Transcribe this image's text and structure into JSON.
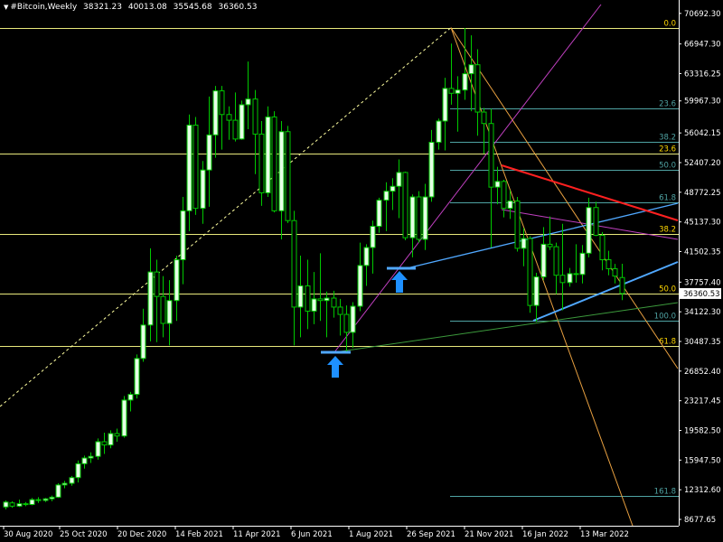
{
  "header": {
    "symbol": "#Bitcoin,Weekly",
    "open": "38321.23",
    "high": "40013.08",
    "low": "35545.68",
    "close": "36360.53",
    "menu_icon": "triangle-down-icon"
  },
  "colors": {
    "background": "#000000",
    "bull": "#e6ffe6",
    "bear": "#000000",
    "wick": "#00c800",
    "grid_axis": "#ffffff",
    "h_levels": "#e8e87c",
    "fib_retr": "#4fa3a3",
    "fib_fan_orange": "#e8a040",
    "pitchfork_magenta": "#c040c0",
    "channel_blue": "#50a8ff",
    "trend_red": "#ff2020",
    "trend_green": "#3c9a3c",
    "arrow_blue": "#1e90ff",
    "dotted_white": "#ffffa0"
  },
  "y_axis": {
    "labels": [
      "70692.30",
      "66947.30",
      "63316.25",
      "59967.30",
      "56042.15",
      "52407.20",
      "48772.25",
      "45137.30",
      "41502.35",
      "37757.40",
      "34122.30",
      "30487.35",
      "26852.40",
      "23217.45",
      "19582.50",
      "15947.50",
      "12312.60",
      "8677.65"
    ],
    "current_price": "36360.53"
  },
  "x_axis": {
    "labels": [
      "30 Aug 2020",
      "25 Oct 2020",
      "20 Dec 2020",
      "14 Feb 2021",
      "11 Apr 2021",
      "6 Jun 2021",
      "1 Aug 2021",
      "26 Sep 2021",
      "21 Nov 2021",
      "16 Jan 2022",
      "13 Mar 2022"
    ]
  },
  "horizontal_levels": [
    {
      "price": 68950,
      "label": "0.0"
    },
    {
      "price": 53500,
      "label": "23.6"
    },
    {
      "price": 43700,
      "label": "38.2"
    },
    {
      "price": 36400,
      "label": "50.0"
    },
    {
      "price": 29900,
      "label": "61.8"
    }
  ],
  "fib_retracement_levels": [
    {
      "price": 59100,
      "label": "23.6"
    },
    {
      "price": 55000,
      "label": "38.2"
    },
    {
      "price": 51500,
      "label": "50.0"
    },
    {
      "price": 47500,
      "label": "61.8"
    },
    {
      "price": 33000,
      "label": "100.0"
    },
    {
      "price": 11600,
      "label": "161.8"
    }
  ],
  "annotations": [
    {
      "type": "arrow-up",
      "name": "buy-arrow-icon"
    },
    {
      "type": "arrow-up",
      "name": "buy-arrow-icon"
    }
  ],
  "chart_data": {
    "type": "candlestick",
    "title": "#Bitcoin,Weekly",
    "ohlc_header": {
      "open": 38321.23,
      "high": 40013.08,
      "low": 35545.68,
      "close": 36360.53
    },
    "ylim": [
      8000,
      71500
    ],
    "y_ticks": [
      70692.3,
      66947.3,
      63316.25,
      59967.3,
      56042.15,
      52407.2,
      48772.25,
      45137.3,
      41502.35,
      37757.4,
      34122.3,
      30487.35,
      26852.4,
      23217.45,
      19582.5,
      15947.5,
      12312.6,
      8677.65
    ],
    "candles": [
      {
        "o": 10200,
        "h": 11000,
        "l": 9900,
        "c": 10800
      },
      {
        "o": 10700,
        "h": 10900,
        "l": 10100,
        "c": 10300
      },
      {
        "o": 10300,
        "h": 11100,
        "l": 10200,
        "c": 10600
      },
      {
        "o": 10600,
        "h": 10800,
        "l": 10300,
        "c": 10500
      },
      {
        "o": 10500,
        "h": 11300,
        "l": 10400,
        "c": 11100
      },
      {
        "o": 11100,
        "h": 11400,
        "l": 10700,
        "c": 11000
      },
      {
        "o": 11000,
        "h": 11300,
        "l": 10800,
        "c": 11200
      },
      {
        "o": 11200,
        "h": 11600,
        "l": 10900,
        "c": 11400
      },
      {
        "o": 11400,
        "h": 13100,
        "l": 11300,
        "c": 12900
      },
      {
        "o": 12900,
        "h": 13400,
        "l": 12500,
        "c": 13100
      },
      {
        "o": 13100,
        "h": 14000,
        "l": 12800,
        "c": 13800
      },
      {
        "o": 13800,
        "h": 15900,
        "l": 13200,
        "c": 15500
      },
      {
        "o": 15500,
        "h": 16500,
        "l": 14900,
        "c": 16200
      },
      {
        "o": 16200,
        "h": 16900,
        "l": 15600,
        "c": 16400
      },
      {
        "o": 16400,
        "h": 18600,
        "l": 16000,
        "c": 18200
      },
      {
        "o": 18200,
        "h": 19300,
        "l": 16700,
        "c": 17800
      },
      {
        "o": 17800,
        "h": 19600,
        "l": 17400,
        "c": 19200
      },
      {
        "o": 19200,
        "h": 19800,
        "l": 18200,
        "c": 18900
      },
      {
        "o": 18900,
        "h": 23800,
        "l": 18700,
        "c": 23300
      },
      {
        "o": 23300,
        "h": 24300,
        "l": 21900,
        "c": 24000
      },
      {
        "o": 24000,
        "h": 28900,
        "l": 23500,
        "c": 28400
      },
      {
        "o": 28400,
        "h": 34500,
        "l": 28000,
        "c": 32500
      },
      {
        "o": 32500,
        "h": 41900,
        "l": 30500,
        "c": 39000
      },
      {
        "o": 39000,
        "h": 40500,
        "l": 30400,
        "c": 36000
      },
      {
        "o": 36000,
        "h": 38500,
        "l": 31000,
        "c": 32700
      },
      {
        "o": 32700,
        "h": 38000,
        "l": 30000,
        "c": 35500
      },
      {
        "o": 35500,
        "h": 41000,
        "l": 33000,
        "c": 40500
      },
      {
        "o": 40500,
        "h": 48200,
        "l": 37500,
        "c": 46500
      },
      {
        "o": 46500,
        "h": 58300,
        "l": 44000,
        "c": 57000
      },
      {
        "o": 57000,
        "h": 58000,
        "l": 46000,
        "c": 46800
      },
      {
        "o": 46800,
        "h": 52600,
        "l": 44900,
        "c": 51500
      },
      {
        "o": 51500,
        "h": 60500,
        "l": 47000,
        "c": 55800
      },
      {
        "o": 55800,
        "h": 61800,
        "l": 53000,
        "c": 61200
      },
      {
        "o": 61200,
        "h": 61800,
        "l": 54000,
        "c": 58300
      },
      {
        "o": 58300,
        "h": 59300,
        "l": 55200,
        "c": 57600
      },
      {
        "o": 57600,
        "h": 61000,
        "l": 55000,
        "c": 55300
      },
      {
        "o": 55300,
        "h": 60000,
        "l": 55200,
        "c": 59500
      },
      {
        "o": 59500,
        "h": 64800,
        "l": 56500,
        "c": 60200
      },
      {
        "o": 60200,
        "h": 61300,
        "l": 51000,
        "c": 55900
      },
      {
        "o": 55900,
        "h": 57500,
        "l": 47100,
        "c": 48700
      },
      {
        "o": 48700,
        "h": 59300,
        "l": 48200,
        "c": 58000
      },
      {
        "o": 58000,
        "h": 58700,
        "l": 46300,
        "c": 46500
      },
      {
        "o": 46500,
        "h": 57500,
        "l": 43000,
        "c": 56200
      },
      {
        "o": 56200,
        "h": 56900,
        "l": 45000,
        "c": 45300
      },
      {
        "o": 45300,
        "h": 46500,
        "l": 30000,
        "c": 34700
      },
      {
        "o": 34700,
        "h": 41000,
        "l": 31000,
        "c": 37300
      },
      {
        "o": 37300,
        "h": 40500,
        "l": 32000,
        "c": 34200
      },
      {
        "o": 34200,
        "h": 39000,
        "l": 32600,
        "c": 35700
      },
      {
        "o": 35700,
        "h": 41300,
        "l": 33000,
        "c": 35500
      },
      {
        "o": 35500,
        "h": 36600,
        "l": 31000,
        "c": 35800
      },
      {
        "o": 35800,
        "h": 36700,
        "l": 33400,
        "c": 34700
      },
      {
        "o": 34700,
        "h": 35700,
        "l": 31200,
        "c": 33800
      },
      {
        "o": 33800,
        "h": 34900,
        "l": 29300,
        "c": 31600
      },
      {
        "o": 31600,
        "h": 35300,
        "l": 29700,
        "c": 34800
      },
      {
        "o": 34800,
        "h": 42600,
        "l": 34200,
        "c": 39800
      },
      {
        "o": 39800,
        "h": 42400,
        "l": 37300,
        "c": 42000
      },
      {
        "o": 42000,
        "h": 45300,
        "l": 38800,
        "c": 44600
      },
      {
        "o": 44600,
        "h": 48100,
        "l": 43800,
        "c": 47800
      },
      {
        "o": 47800,
        "h": 50000,
        "l": 44000,
        "c": 48900
      },
      {
        "o": 48900,
        "h": 50500,
        "l": 46600,
        "c": 49500
      },
      {
        "o": 49500,
        "h": 52800,
        "l": 45600,
        "c": 51200
      },
      {
        "o": 51200,
        "h": 51300,
        "l": 42900,
        "c": 43200
      },
      {
        "o": 43200,
        "h": 48500,
        "l": 40800,
        "c": 48200
      },
      {
        "o": 48200,
        "h": 48900,
        "l": 42600,
        "c": 43000
      },
      {
        "o": 43000,
        "h": 49800,
        "l": 41700,
        "c": 48200
      },
      {
        "o": 48200,
        "h": 56400,
        "l": 47600,
        "c": 54900
      },
      {
        "o": 54900,
        "h": 57800,
        "l": 54000,
        "c": 57500
      },
      {
        "o": 57500,
        "h": 62800,
        "l": 53900,
        "c": 61500
      },
      {
        "o": 61500,
        "h": 67000,
        "l": 59500,
        "c": 60900
      },
      {
        "o": 60900,
        "h": 63000,
        "l": 56200,
        "c": 61300
      },
      {
        "o": 61300,
        "h": 68900,
        "l": 60100,
        "c": 63300
      },
      {
        "o": 63300,
        "h": 68000,
        "l": 58700,
        "c": 64400
      },
      {
        "o": 64400,
        "h": 66300,
        "l": 55700,
        "c": 58600
      },
      {
        "o": 58600,
        "h": 59100,
        "l": 53500,
        "c": 57200
      },
      {
        "o": 57200,
        "h": 59000,
        "l": 42000,
        "c": 49400
      },
      {
        "o": 49400,
        "h": 51900,
        "l": 47300,
        "c": 50100
      },
      {
        "o": 50100,
        "h": 50300,
        "l": 45700,
        "c": 46800
      },
      {
        "o": 46800,
        "h": 49000,
        "l": 45500,
        "c": 47700
      },
      {
        "o": 47700,
        "h": 48200,
        "l": 41500,
        "c": 41900
      },
      {
        "o": 41900,
        "h": 44400,
        "l": 39700,
        "c": 43100
      },
      {
        "o": 43100,
        "h": 43400,
        "l": 34000,
        "c": 34900
      },
      {
        "o": 34900,
        "h": 38900,
        "l": 32900,
        "c": 38400
      },
      {
        "o": 38400,
        "h": 44500,
        "l": 38000,
        "c": 42400
      },
      {
        "o": 42400,
        "h": 45800,
        "l": 41700,
        "c": 42100
      },
      {
        "o": 42100,
        "h": 42600,
        "l": 36300,
        "c": 38600
      },
      {
        "o": 38600,
        "h": 44900,
        "l": 34300,
        "c": 37700
      },
      {
        "o": 37700,
        "h": 39500,
        "l": 37200,
        "c": 38800
      },
      {
        "o": 38800,
        "h": 42400,
        "l": 37700,
        "c": 38700
      },
      {
        "o": 38700,
        "h": 42300,
        "l": 37600,
        "c": 41300
      },
      {
        "o": 41300,
        "h": 48100,
        "l": 40800,
        "c": 46900
      },
      {
        "o": 46900,
        "h": 47600,
        "l": 43400,
        "c": 43500
      },
      {
        "o": 43500,
        "h": 43900,
        "l": 39200,
        "c": 40500
      },
      {
        "o": 40500,
        "h": 41600,
        "l": 38600,
        "c": 39400
      },
      {
        "o": 39400,
        "h": 40000,
        "l": 37600,
        "c": 38500
      },
      {
        "o": 38321,
        "h": 40013,
        "l": 35545,
        "c": 36360
      }
    ]
  }
}
